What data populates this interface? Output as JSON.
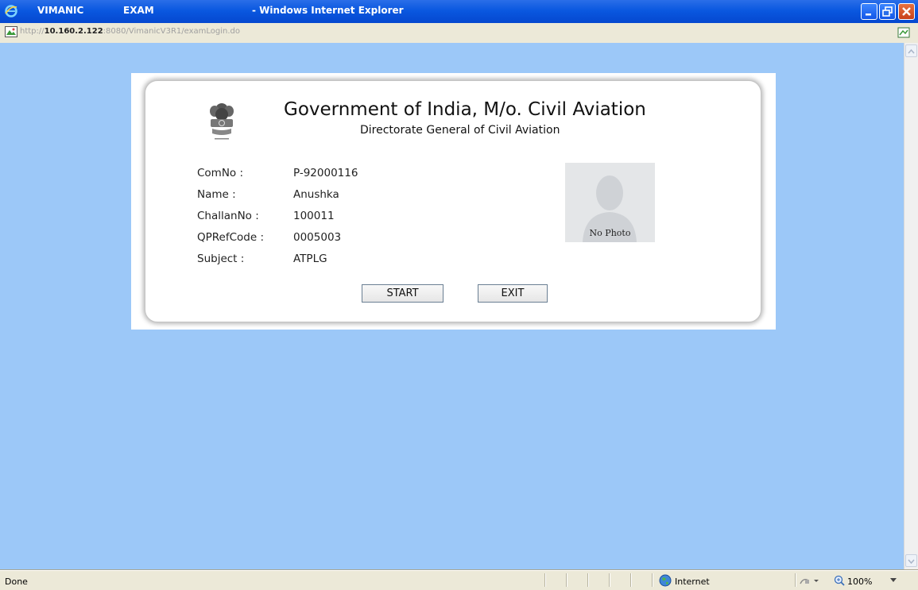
{
  "window": {
    "title_app": "VIMANIC",
    "title_mid": "EXAM",
    "title_browser": "- Windows Internet Explorer"
  },
  "address": {
    "url_prefix": "http://",
    "url_host": "10.160.2.122",
    "url_rest": ":8080/VimanicV3R1/examLogin.do"
  },
  "header": {
    "org_main": "Government of India, M/o. Civil Aviation",
    "org_sub": "Directorate General of Civil Aviation"
  },
  "fields": [
    {
      "label": "ComNo :",
      "value": "P-92000116"
    },
    {
      "label": "Name :",
      "value": "Anushka"
    },
    {
      "label": "ChallanNo :",
      "value": "100011"
    },
    {
      "label": "QPRefCode :",
      "value": "0005003"
    },
    {
      "label": "Subject :",
      "value": "ATPLG"
    }
  ],
  "photo": {
    "caption": "No Photo"
  },
  "buttons": {
    "start": "START",
    "exit": "EXIT"
  },
  "status": {
    "text": "Done",
    "zone": "Internet",
    "zoom": "100%"
  },
  "colors": {
    "page_bg": "#9cc8f8",
    "titlebar": "#0a58e0",
    "panel": "#ffffff"
  }
}
